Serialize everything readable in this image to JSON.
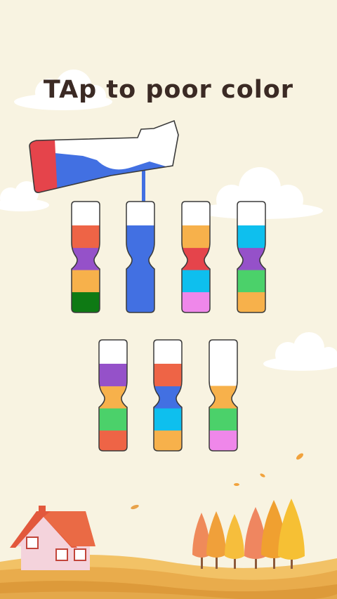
{
  "screen": {
    "headline": "TAp to poor color"
  },
  "colors": {
    "background": "#f8f3e1",
    "red": "#ee6446",
    "purple": "#9551c9",
    "orange": "#f7b14b",
    "dark_green": "#0e7a14",
    "blue": "#4270e2",
    "crimson": "#e5444b",
    "cyan": "#0ebfee",
    "pink": "#ef87ea",
    "green": "#4bd16a"
  },
  "pouring_bottle": {
    "cap_color": "crimson",
    "liquid_color": "blue"
  },
  "tubes": [
    {
      "id": 1,
      "layers": [
        "dark_green",
        "orange",
        "purple",
        "red"
      ]
    },
    {
      "id": 2,
      "layers": [
        "blue",
        "blue",
        "blue",
        "blue"
      ],
      "receiving_pour": true
    },
    {
      "id": 3,
      "layers": [
        "pink",
        "cyan",
        "crimson",
        "orange"
      ]
    },
    {
      "id": 4,
      "layers": [
        "orange",
        "green",
        "purple",
        "cyan"
      ]
    },
    {
      "id": 5,
      "layers": [
        "red",
        "green",
        "orange",
        "purple"
      ]
    },
    {
      "id": 6,
      "layers": [
        "orange",
        "cyan",
        "blue",
        "red"
      ]
    },
    {
      "id": 7,
      "layers": [
        "pink",
        "green",
        "orange"
      ]
    }
  ],
  "scenery": {
    "house": "house-with-red-roof",
    "trees": "autumn-trees",
    "fields": "golden-fields"
  }
}
